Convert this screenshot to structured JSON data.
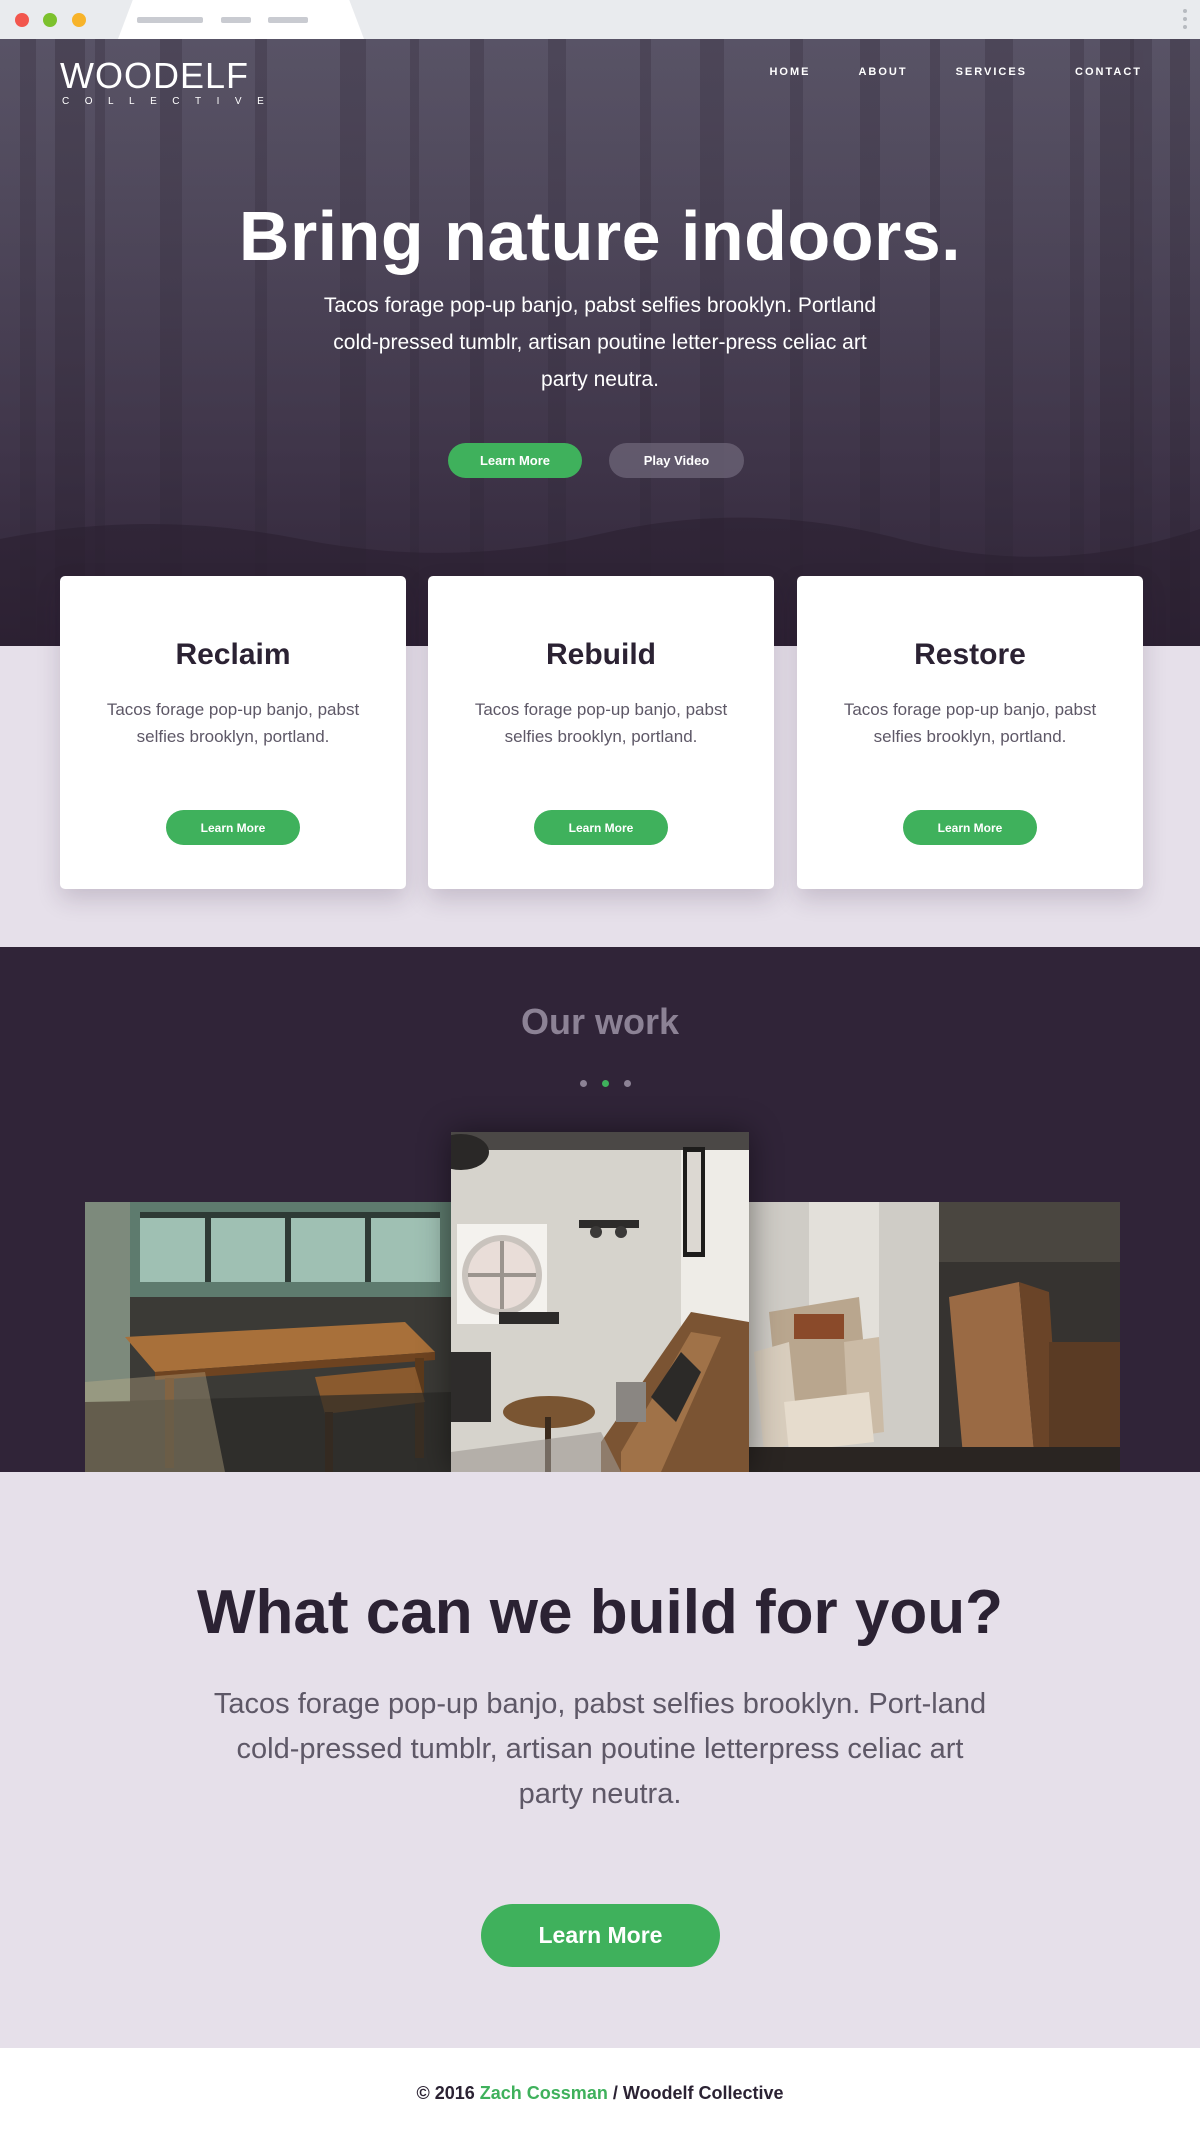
{
  "colors": {
    "accent_green": "#3fb15c",
    "hero_dark": "#3e3349",
    "work_bg": "#302438",
    "light_band": "#e6e0ea",
    "text_dark": "#2b2233"
  },
  "browser": {
    "window_controls": [
      "close-dot",
      "minimize-dot",
      "maximize-dot"
    ]
  },
  "header": {
    "logo_main": "WOODELF",
    "logo_sub": "COLLECTIVE",
    "nav": [
      "HOME",
      "ABOUT",
      "SERVICES",
      "CONTACT"
    ]
  },
  "hero": {
    "title": "Bring nature indoors.",
    "text": "Tacos forage pop-up banjo, pabst selfies brooklyn. Portland cold-pressed tumblr, artisan poutine letter-press celiac art party neutra.",
    "primary_button": "Learn More",
    "secondary_button": "Play Video"
  },
  "cards": [
    {
      "title": "Reclaim",
      "text": "Tacos forage pop-up banjo, pabst selfies brooklyn, portland.",
      "button": "Learn More"
    },
    {
      "title": "Rebuild",
      "text": "Tacos forage pop-up banjo, pabst selfies brooklyn, portland.",
      "button": "Learn More"
    },
    {
      "title": "Restore",
      "text": "Tacos forage pop-up banjo, pabst selfies brooklyn, portland.",
      "button": "Learn More"
    }
  ],
  "work": {
    "title": "Our work",
    "carousel_active_index": 1,
    "carousel_count": 3
  },
  "build": {
    "title": "What can we build for you?",
    "text": "Tacos forage pop-up banjo, pabst selfies brooklyn. Port-land cold-pressed tumblr, artisan poutine letterpress celiac art party neutra.",
    "button": "Learn More"
  },
  "footer": {
    "prefix": "© 2016",
    "author": "Zach Cossman",
    "suffix": "/ Woodelf Collective"
  }
}
